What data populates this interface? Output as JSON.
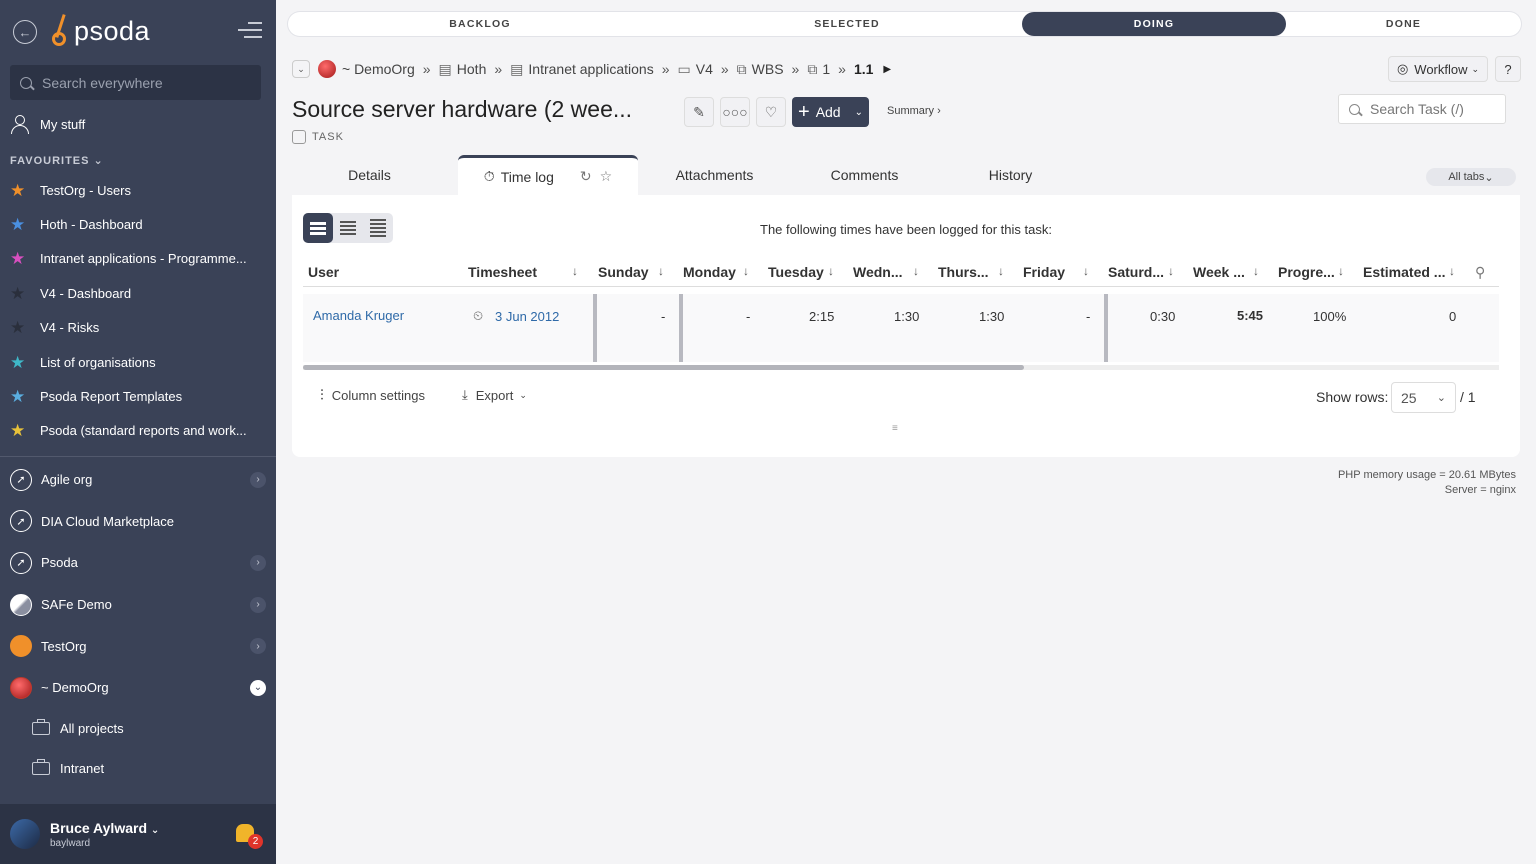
{
  "sidebar": {
    "logo": "psoda",
    "search_placeholder": "Search everywhere",
    "my_stuff": "My stuff",
    "favourites_heading": "FAVOURITES",
    "favourites": [
      {
        "label": "TestOrg - Users",
        "color": "#f0902a"
      },
      {
        "label": "Hoth - Dashboard",
        "color": "#4a90e2"
      },
      {
        "label": "Intranet applications - Programme...",
        "color": "#d84fc0"
      },
      {
        "label": "V4 - Dashboard",
        "color": "#2a2f3c"
      },
      {
        "label": "V4 - Risks",
        "color": "#2a2f3c"
      },
      {
        "label": "List of organisations",
        "color": "#3fb8c8"
      },
      {
        "label": "Psoda Report Templates",
        "color": "#5aaee0"
      },
      {
        "label": "Psoda (standard reports and work...",
        "color": "#e8c23a"
      }
    ],
    "orgs": [
      {
        "label": "Agile org",
        "chevron": true
      },
      {
        "label": "DIA Cloud Marketplace",
        "chevron": false
      },
      {
        "label": "Psoda",
        "chevron": true
      },
      {
        "label": "SAFe Demo",
        "chevron": true
      },
      {
        "label": "TestOrg",
        "chevron": true
      },
      {
        "label": "~ DemoOrg",
        "chevron": true
      }
    ],
    "subitems": [
      "All projects",
      "Intranet"
    ],
    "user": {
      "name": "Bruce Aylward",
      "handle": "baylward",
      "notifications": "2"
    }
  },
  "steps": [
    "BACKLOG",
    "SELECTED",
    "DOING",
    "DONE"
  ],
  "breadcrumb": [
    "~ DemoOrg",
    "Hoth",
    "Intranet applications",
    "V4",
    "WBS",
    "1",
    "1.1"
  ],
  "workflow_label": "Workflow",
  "help_label": "?",
  "title": "Source server hardware (2 wee...",
  "type_label": "TASK",
  "add_label": "Add",
  "summary_link": "Summary ›",
  "task_search_placeholder": "Search Task (/)",
  "tabs": [
    "Details",
    "Time log",
    "Attachments",
    "Comments",
    "History"
  ],
  "all_tabs": "All tabs",
  "panel_message": "The following times have been logged for this task:",
  "columns": [
    "User",
    "Timesheet",
    "Sunday",
    "Monday",
    "Tuesday",
    "Wedn...",
    "Thurs...",
    "Friday",
    "Saturd...",
    "Week ...",
    "Progre...",
    "Estimated ..."
  ],
  "row": {
    "user": "Amanda Kruger",
    "timesheet": "3 Jun 2012",
    "sunday": "-",
    "monday": "-",
    "tuesday": "2:15",
    "wednesday": "1:30",
    "thursday": "1:30",
    "friday": "-",
    "saturday": "0:30",
    "week": "5:45",
    "progress": "100%",
    "estimated": "0"
  },
  "column_settings": "Column settings",
  "export_label": "Export",
  "show_rows_label": "Show rows:",
  "rows_per_page": "25",
  "page_total": "/ 1",
  "footer": {
    "memory": "PHP memory usage = 20.61 MBytes",
    "server": "Server = nginx"
  }
}
